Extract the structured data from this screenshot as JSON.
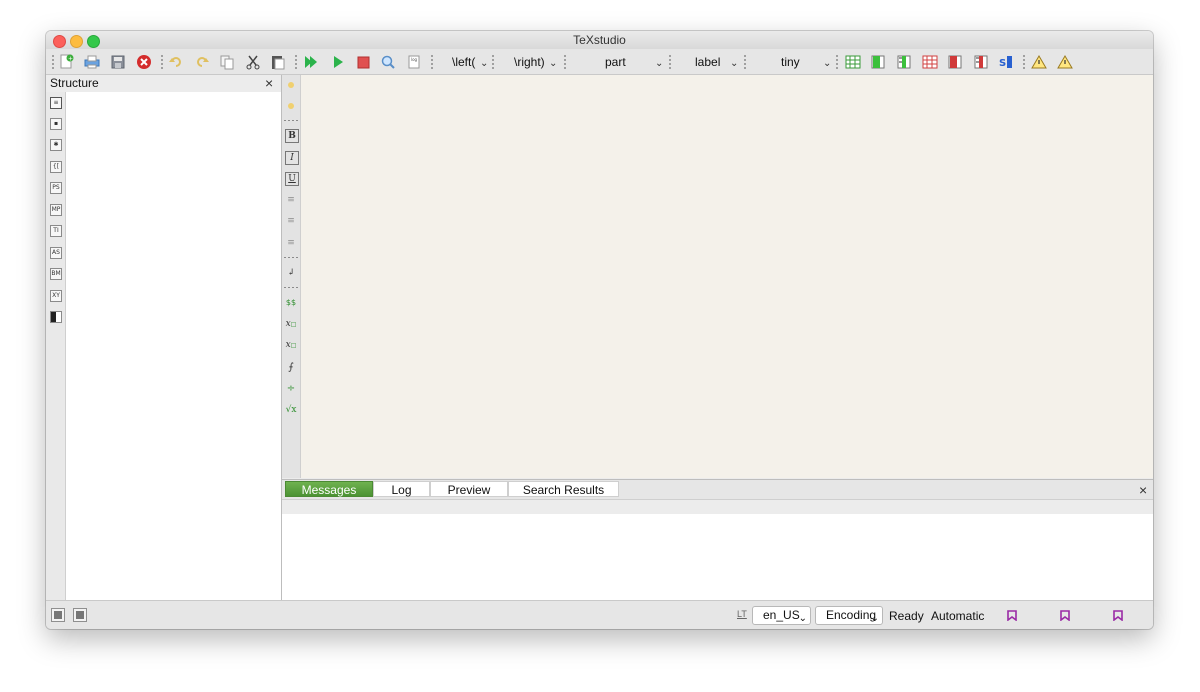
{
  "window": {
    "title": "TeXstudio"
  },
  "toolbar": {
    "combos": [
      {
        "id": "left",
        "label": "\\left("
      },
      {
        "id": "right",
        "label": "\\right)"
      },
      {
        "id": "sectioning",
        "label": "part"
      },
      {
        "id": "references",
        "label": "label"
      },
      {
        "id": "size",
        "label": "tiny"
      }
    ]
  },
  "structure": {
    "title": "Structure",
    "close": "×",
    "side_icons": [
      "structure-icon",
      "bookmark-icon",
      "asterisk-icon",
      "brace-icon",
      "ps-icon",
      "mp-icon",
      "ti-icon",
      "as-icon",
      "bm-icon",
      "xy-icon",
      "checker-icon"
    ],
    "side_labels": [
      "",
      "",
      "✱",
      "{[",
      "PS",
      "MP",
      "TI",
      "AS",
      "BM",
      "XY",
      ""
    ]
  },
  "vtoolbar": {
    "bold": "B",
    "italic": "I",
    "underline": "U",
    "dollar": "$$"
  },
  "bottom_panel": {
    "tabs": [
      "Messages",
      "Log",
      "Preview",
      "Search Results"
    ],
    "active_tab": "Messages",
    "close": "×"
  },
  "statusbar": {
    "lt": "LT",
    "language": "en_US",
    "encoding": "Encoding",
    "status": "Ready",
    "mode": "Automatic"
  },
  "colors": {
    "editor_bg": "#f4f1ea",
    "tab_active": "#58a23c",
    "run_green": "#2bb34b",
    "stop_red": "#e05050"
  }
}
